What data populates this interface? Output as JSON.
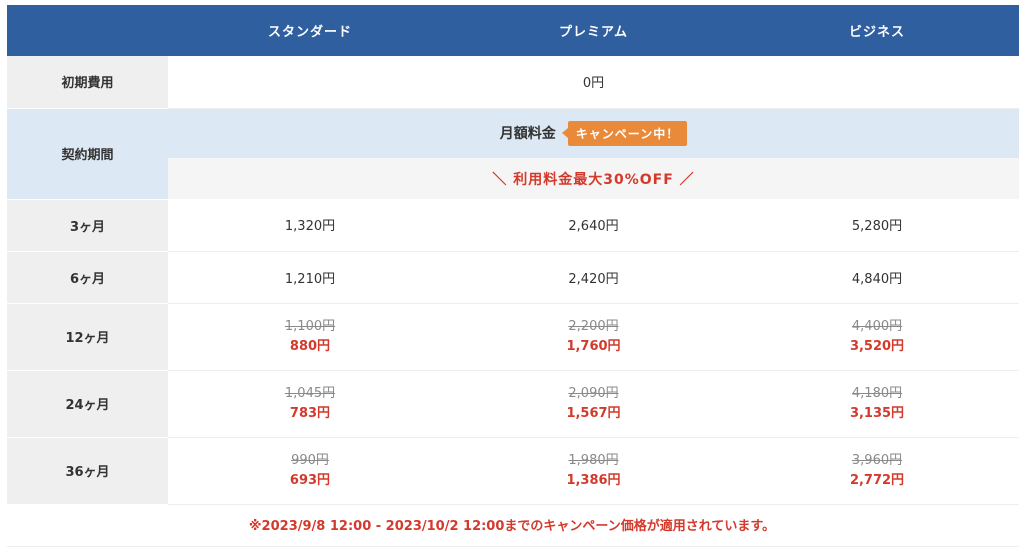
{
  "header": {
    "columns": [
      "スタンダード",
      "プレミアム",
      "ビジネス"
    ]
  },
  "initial_fee": {
    "label": "初期費用",
    "value": "0円"
  },
  "contract": {
    "label": "契約期間",
    "monthly_label": "月額料金",
    "campaign_badge": "キャンペーン中！",
    "discount_text": "＼ 利用料金最大30%OFF ／"
  },
  "rows": [
    {
      "label": "3ヶ月",
      "prices": [
        "1,320円",
        "2,640円",
        "5,280円"
      ]
    },
    {
      "label": "6ヶ月",
      "prices": [
        "1,210円",
        "2,420円",
        "4,840円"
      ]
    },
    {
      "label": "12ヶ月",
      "old": [
        "1,100円",
        "2,200円",
        "4,400円"
      ],
      "new": [
        "880円",
        "1,760円",
        "3,520円"
      ]
    },
    {
      "label": "24ヶ月",
      "old": [
        "1,045円",
        "2,090円",
        "4,180円"
      ],
      "new": [
        "783円",
        "1,567円",
        "3,135円"
      ]
    },
    {
      "label": "36ヶ月",
      "old": [
        "990円",
        "1,980円",
        "3,960円"
      ],
      "new": [
        "693円",
        "1,386円",
        "2,772円"
      ]
    }
  ],
  "note": "※2023/9/8 12:00 - 2023/10/2 12:00までのキャンペーン価格が適用されています。",
  "colors": {
    "header_bg": "#2f5f9f",
    "accent_red": "#d33a2c",
    "badge_orange": "#e98a3a",
    "row_head_bg": "#efefef",
    "monthly_bg": "#dce8f3"
  }
}
